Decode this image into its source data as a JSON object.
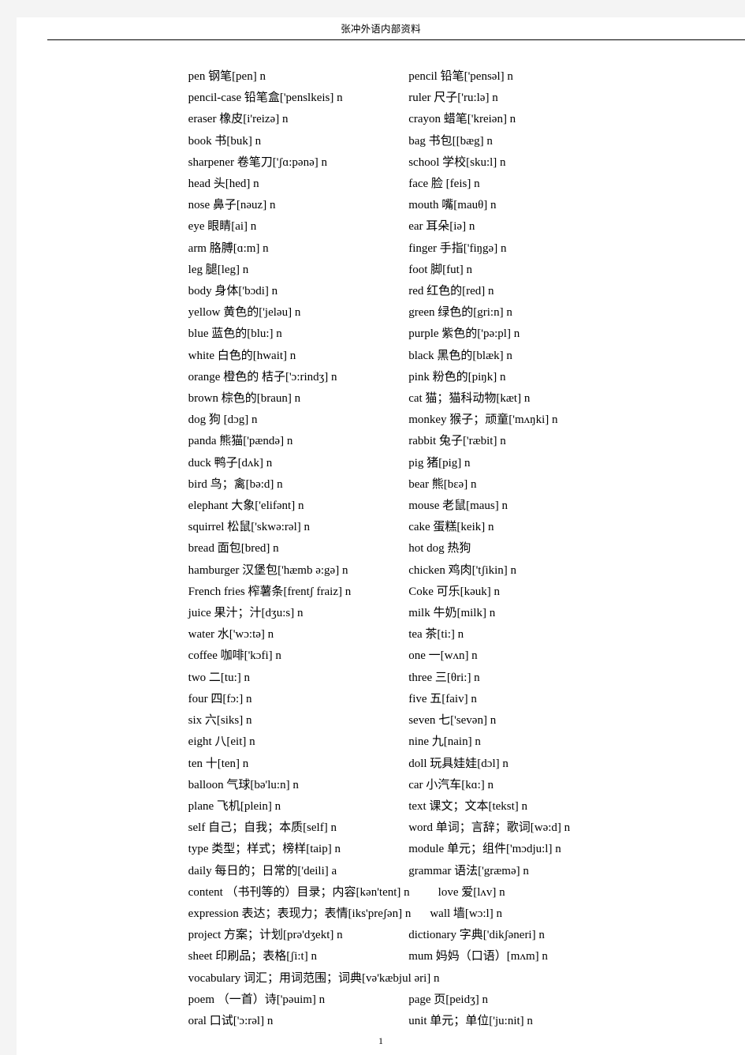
{
  "header": {
    "title": "张冲外语内部资料"
  },
  "footer": {
    "page_number": "1"
  },
  "entries": {
    "rows": [
      {
        "left": "pen  钢笔[pen] n",
        "right": "pencil 铅笔['pensəl] n"
      },
      {
        "left": "pencil-case 铅笔盒['penslkeis] n",
        "right": "ruler  尺子['ru:lə] n"
      },
      {
        "left": "eraser  橡皮[i'reizə] n",
        "right": "crayon  蜡笔['kreiən] n"
      },
      {
        "left": "book  书[buk] n",
        "right": "bag  书包[[bæg] n"
      },
      {
        "left": "sharpener  卷笔刀['ʃɑ:pənə] n",
        "right": "school  学校[sku:l] n"
      },
      {
        "left": "head  头[hed] n",
        "right": "face  脸 [feis] n"
      },
      {
        "left": "nose 鼻子[nəuz] n",
        "right": "mouth  嘴[mauθ] n"
      },
      {
        "left": "eye  眼睛[ai] n",
        "right": "ear  耳朵[iə] n"
      },
      {
        "left": "arm 胳膊[ɑ:m] n",
        "right": "finger  手指['fiŋgə] n"
      },
      {
        "left": "leg  腿[leg] n",
        "right": "foot  脚[fut] n"
      },
      {
        "left": "body  身体['bɔdi] n",
        "right": "red  红色的[red] n"
      },
      {
        "left": "yellow  黄色的['jeləu] n",
        "right": "green  绿色的[gri:n] n"
      },
      {
        "left": "blue  蓝色的[blu:] n",
        "right": "purple  紫色的['pə:pl] n"
      },
      {
        "left": "white  白色的[hwait] n",
        "right": "black  黑色的[blæk] n"
      },
      {
        "left": "orange  橙色的 桔子['ɔ:rindʒ] n",
        "right": "pink  粉色的[piŋk] n"
      },
      {
        "left": "brown  棕色的[braun] n",
        "right": "cat  猫；猫科动物[kæt] n"
      },
      {
        "left": "dog  狗  [dɔg] n",
        "right": "monkey  猴子；顽童['mʌŋki] n"
      },
      {
        "left": "panda  熊猫['pændə] n",
        "right": "rabbit  兔子['ræbit] n"
      },
      {
        "left": "duck  鸭子[dʌk] n",
        "right": "pig  猪[pig] n"
      },
      {
        "left": "bird  鸟；禽[bə:d] n",
        "right": "bear  熊[bɛə] n"
      },
      {
        "left": "elephant  大象['elifənt] n",
        "right": "mouse  老鼠[maus] n"
      },
      {
        "left": "squirrel  松鼠['skwə:rəl] n",
        "right": "cake  蛋糕[keik] n"
      },
      {
        "left": "bread  面包[bred] n",
        "right": "hot dog  热狗"
      },
      {
        "left": "hamburger 汉堡包['hæmb ə:gə] n",
        "right": "chicken  鸡肉['tʃikin] n"
      },
      {
        "left": "French  fries  榨薯条[frentʃ fraiz] n",
        "right": "Coke  可乐[kəuk] n"
      },
      {
        "left": "juice  果汁；汁[dʒu:s] n",
        "right": "milk  牛奶[milk] n"
      },
      {
        "left": "water  水['wɔ:tə] n",
        "right": "tea  茶[ti:] n"
      },
      {
        "left": "coffee  咖啡['kɔfi] n",
        "right": "one 一[wʌn] n"
      },
      {
        "left": "two  二[tu:] n",
        "right": "three  三[θri:] n"
      },
      {
        "left": "four  四[fɔ:] n",
        "right": "five  五[faiv] n"
      },
      {
        "left": "six  六[siks] n",
        "right": "seven  七['sevən] n"
      },
      {
        "left": "eight  八[eit] n",
        "right": "nine  九[nain] n"
      },
      {
        "left": "ten  十[ten] n",
        "right": "doll  玩具娃娃[dɔl] n"
      },
      {
        "left": "balloon  气球[bə'lu:n] n",
        "right": "car  小汽车[kɑ:] n"
      },
      {
        "left": "plane  飞机[plein] n",
        "right": "text  课文；文本[tekst] n"
      },
      {
        "left": "self  自己；自我；本质[self] n",
        "right": "word  单词；言辞；歌词[wə:d] n"
      },
      {
        "left": "type  类型；样式；榜样[taip] n",
        "right": "module  单元；组件['mɔdju:l] n"
      },
      {
        "left": "daily  每日的；日常的['deili] a",
        "right": "grammar 语法['græmə] n"
      }
    ],
    "wide_rows": [
      {
        "text": "content  （书刊等的）目录；内容[kən'tent] n",
        "trailing": "love  爱[lʌv] n",
        "indent": false
      },
      {
        "text": " expression  表达；表现力；表情[iks'preʃən] n",
        "trailing": "wall  墙[wɔ:l] n",
        "indent": true
      }
    ],
    "rows2": [
      {
        "left": "project  方案；计划[prə'dʒekt] n",
        "right": "dictionary  字典['dikʃəneri] n"
      },
      {
        "left": "sheet  印刷品；表格[ʃi:t] n",
        "right": "mum  妈妈（口语）[mʌm] n"
      }
    ],
    "wide_rows2": [
      {
        "text": "vocabulary  词汇；用词范围；词典[və'kæbjul əri] n",
        "trailing": "",
        "indent": false
      }
    ],
    "rows3": [
      {
        "left": "poem  （一首）诗['pəuim] n",
        "right": "page  页[peidʒ] n"
      },
      {
        "left": "oral  口试['ɔ:rəl] n",
        "right": "unit  单元；单位['ju:nit] n"
      }
    ]
  }
}
